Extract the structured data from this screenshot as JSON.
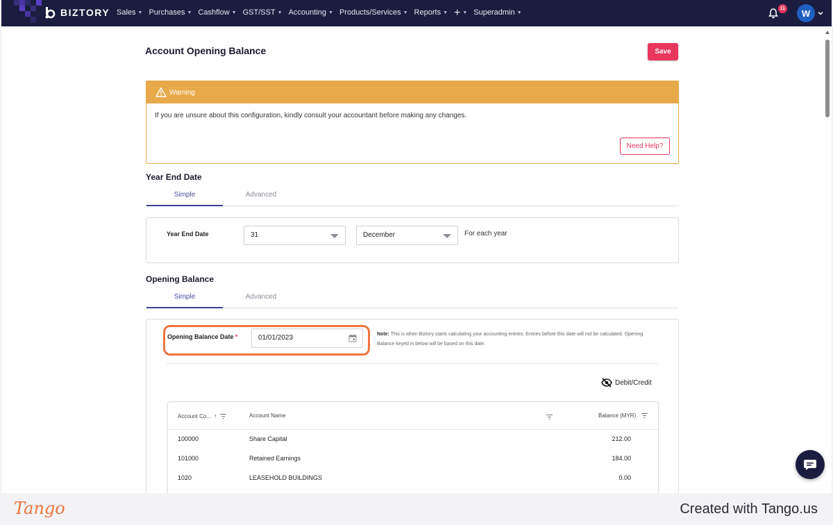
{
  "brand": {
    "name": "BIZTORY"
  },
  "nav": {
    "items": [
      "Sales",
      "Purchases",
      "Cashflow",
      "GST/SST",
      "Accounting",
      "Products/Services",
      "Reports"
    ],
    "plus": "+",
    "superadmin": "Superadmin",
    "notification_count": "11",
    "avatar_initial": "W"
  },
  "page": {
    "title": "Account Opening Balance",
    "save_label": "Save"
  },
  "warning": {
    "title": "Warning",
    "message": "If you are unsure about this configuration, kindly consult your accountant before making any changes.",
    "help_label": "Need Help?"
  },
  "year_end": {
    "section_title": "Year End Date",
    "tabs": [
      "Simple",
      "Advanced"
    ],
    "field_label": "Year End Date",
    "day": "31",
    "month": "December",
    "suffix": "For each year"
  },
  "opening_balance": {
    "section_title": "Opening Balance",
    "tabs": [
      "Simple",
      "Advanced"
    ],
    "date_label": "Opening Balance Date",
    "required_mark": "*",
    "date_value": "01/01/2023",
    "note_prefix": "Note:",
    "note_text": " This is when Biztory starts calculating your accounting entries. Entries before this date will not be calculated. Opening Balance keyed in below will be based on this date.",
    "toggle_label": "Debit/Credit"
  },
  "table": {
    "columns": [
      "Account Co...",
      "Account Name",
      "Balance (MYR)"
    ],
    "sort_indicator": "↑",
    "rows": [
      {
        "code": "100000",
        "name": "Share Capital",
        "balance": "212.00"
      },
      {
        "code": "101000",
        "name": "Retained Earnings",
        "balance": "184.00"
      },
      {
        "code": "1020",
        "name": "LEASEHOLD BUILDINGS",
        "balance": "0.00"
      }
    ]
  },
  "footer": {
    "logo": "Tango",
    "credit": "Created with Tango.us"
  },
  "colors": {
    "nav_bg": "#1b1d40",
    "accent": "#e8365d",
    "warning": "#e8a94a",
    "highlight": "#f0743e",
    "tab_active": "#3b3f8f"
  }
}
